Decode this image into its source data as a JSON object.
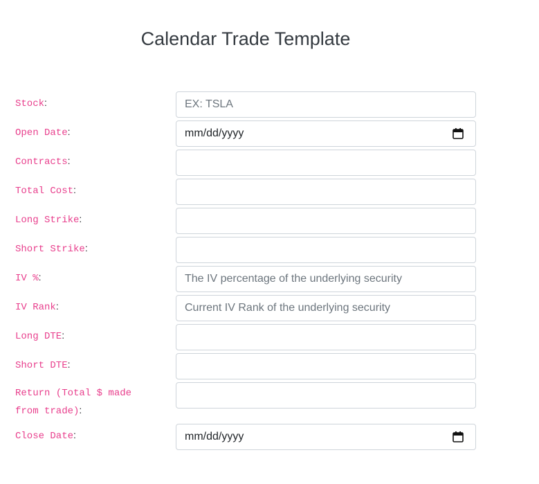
{
  "title": "Calendar Trade Template",
  "form": {
    "stock": {
      "label": "Stock",
      "placeholder": "EX: TSLA",
      "value": ""
    },
    "open_date": {
      "label": "Open Date",
      "display": "mm/dd/yyyy"
    },
    "contracts": {
      "label": "Contracts",
      "placeholder": "",
      "value": ""
    },
    "total_cost": {
      "label": "Total Cost",
      "placeholder": "",
      "value": ""
    },
    "long_strike": {
      "label": "Long Strike",
      "placeholder": "",
      "value": ""
    },
    "short_strike": {
      "label": "Short Strike",
      "placeholder": "",
      "value": ""
    },
    "iv_pct": {
      "label": "IV %",
      "placeholder": "The IV percentage of the underlying security",
      "value": ""
    },
    "iv_rank": {
      "label": "IV Rank",
      "placeholder": "Current IV Rank of the underlying security",
      "value": ""
    },
    "long_dte": {
      "label": "Long DTE",
      "placeholder": "",
      "value": ""
    },
    "short_dte": {
      "label": "Short DTE",
      "placeholder": "",
      "value": ""
    },
    "return": {
      "label": "Return (Total $ made from trade)",
      "placeholder": "",
      "value": ""
    },
    "close_date": {
      "label": "Close Date",
      "display": "mm/dd/yyyy"
    }
  },
  "colon": ":",
  "icons": {
    "date_picker": "calendar-icon"
  },
  "colors": {
    "label": "#e83e8c",
    "title": "#343a40",
    "border": "#ced4da"
  }
}
